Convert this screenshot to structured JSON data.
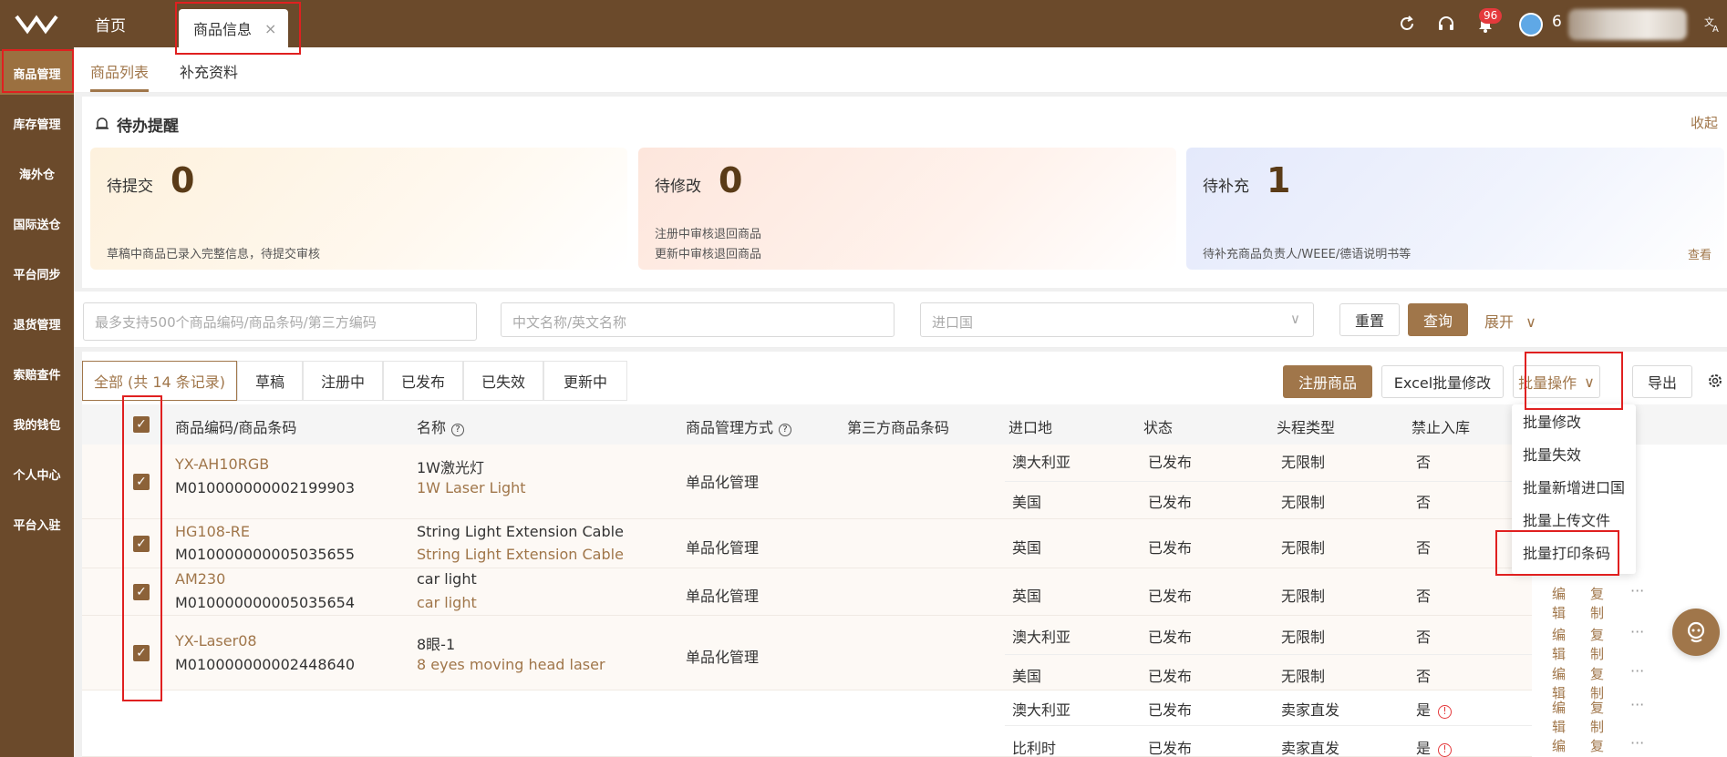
{
  "topbar": {
    "home_tab": "首页",
    "active_tab": "商品信息",
    "close_glyph": "×",
    "notifications_count": "96",
    "username_prefix": "6"
  },
  "sidebar": {
    "items": [
      "商品管理",
      "库存管理",
      "海外仓",
      "国际送仓",
      "平台同步",
      "退货管理",
      "索赔查件",
      "我的钱包",
      "个人中心",
      "平台入驻"
    ]
  },
  "subnav": {
    "tabs": [
      "商品列表",
      "补充资料"
    ]
  },
  "todo": {
    "title": "待办提醒",
    "collapse": "收起",
    "cards": [
      {
        "label": "待提交",
        "count": "0",
        "desc": [
          "草稿中商品已录入完整信息，待提交审核"
        ]
      },
      {
        "label": "待修改",
        "count": "0",
        "desc": [
          "注册中审核退回商品",
          "更新中审核退回商品"
        ]
      },
      {
        "label": "待补充",
        "count": "1",
        "desc": [
          "待补充商品负责人/WEEE/德语说明书等"
        ],
        "view": "查看"
      }
    ]
  },
  "filter": {
    "code_placeholder": "最多支持500个商品编码/商品条码/第三方编码",
    "name_placeholder": "中文名称/英文名称",
    "country_placeholder": "进口国",
    "reset": "重置",
    "query": "查询",
    "expand": "展开"
  },
  "status_tabs": [
    "全部 (共 14 条记录)",
    "草稿",
    "注册中",
    "已发布",
    "已失效",
    "更新中"
  ],
  "actions": {
    "register": "注册商品",
    "excel": "Excel批量修改",
    "batch": "批量操作",
    "export": "导出"
  },
  "batch_menu": [
    "批量修改",
    "批量失效",
    "批量新增进口国",
    "批量上传文件",
    "批量打印条码"
  ],
  "columns": [
    "商品编码/商品条码",
    "名称",
    "商品管理方式",
    "第三方商品条码",
    "进口地",
    "状态",
    "头程类型",
    "禁止入库"
  ],
  "rows": [
    {
      "code": "YX-AH10RGB",
      "barcode": "M010000000002199903",
      "name_cn": "1W激光灯",
      "name_en": "1W Laser Light",
      "mode": "单品化管理",
      "subs": [
        {
          "country": "澳大利亚",
          "status": "已发布",
          "type": "无限制",
          "ban": "否"
        },
        {
          "country": "美国",
          "status": "已发布",
          "type": "无限制",
          "ban": "否"
        }
      ]
    },
    {
      "code": "HG108-RE",
      "barcode": "M010000000005035655",
      "name_cn": "String Light Extension Cable",
      "name_en": "String Light Extension Cable",
      "mode": "单品化管理",
      "subs": [
        {
          "country": "英国",
          "status": "已发布",
          "type": "无限制",
          "ban": "否"
        }
      ]
    },
    {
      "code": "AM230",
      "barcode": "M010000000005035654",
      "name_cn": "car light",
      "name_en": "car light",
      "mode": "单品化管理",
      "subs": [
        {
          "country": "英国",
          "status": "已发布",
          "type": "无限制",
          "ban": "否"
        }
      ]
    },
    {
      "code": "YX-Laser08",
      "barcode": "M010000000002448640",
      "name_cn": "8眼-1",
      "name_en": "8 eyes moving head laser",
      "mode": "单品化管理",
      "subs": [
        {
          "country": "澳大利亚",
          "status": "已发布",
          "type": "无限制",
          "ban": "否"
        },
        {
          "country": "美国",
          "status": "已发布",
          "type": "无限制",
          "ban": "否"
        }
      ]
    },
    {
      "code": "",
      "barcode": "",
      "name_cn": "",
      "name_en": "",
      "mode": "",
      "subs": [
        {
          "country": "澳大利亚",
          "status": "已发布",
          "type": "卖家直发",
          "ban": "是"
        },
        {
          "country": "比利时",
          "status": "已发布",
          "type": "卖家直发",
          "ban": "是"
        }
      ]
    }
  ],
  "row_actions": {
    "edit": "编辑",
    "copy": "复制",
    "more": "···"
  },
  "glyphs": {
    "check": "✓",
    "chevron": "∨",
    "question": "?",
    "warn": "!"
  }
}
